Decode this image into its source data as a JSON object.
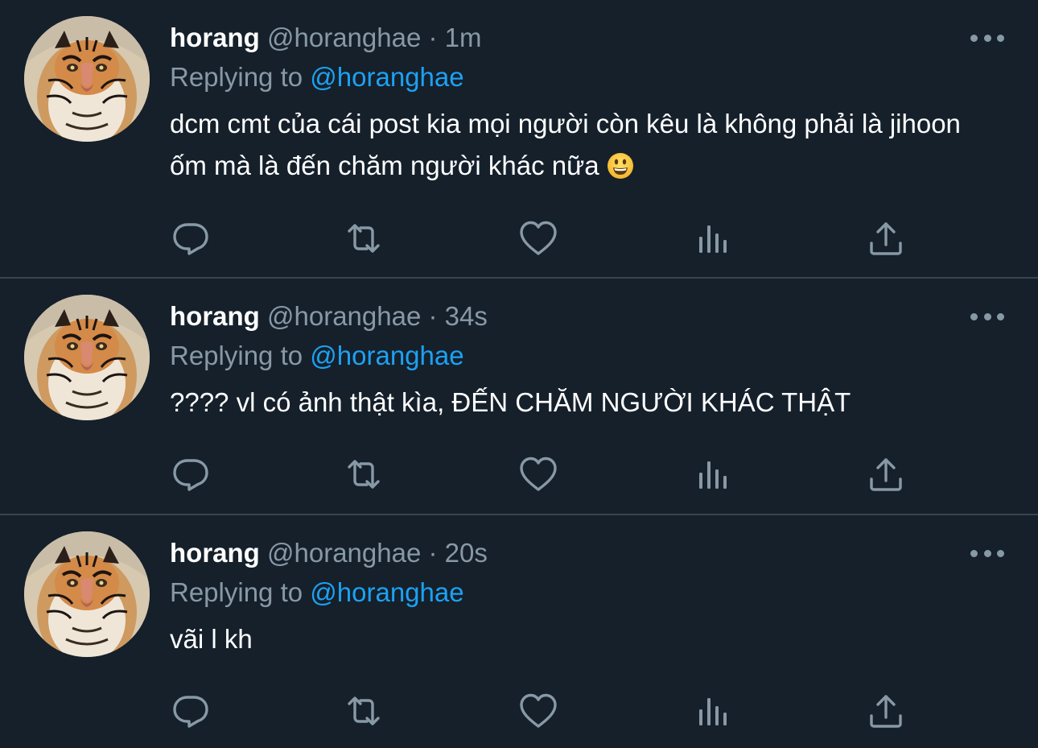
{
  "colors": {
    "background": "#15202b",
    "divider": "#38444d",
    "muted": "#8899a6",
    "link": "#1da1f2",
    "text": "#ffffff"
  },
  "tweets": [
    {
      "name": "horang",
      "handle": "@horanghae",
      "separator": "·",
      "time": "1m",
      "replying_prefix": "Replying to",
      "replying_handle": "@horanghae",
      "text": "dcm cmt của cái post  kia mọi người còn kêu là không phải là jihoon ốm mà là đến chăm người khác nữa",
      "emoji": "grinning-face-emoji"
    },
    {
      "name": "horang",
      "handle": "@horanghae",
      "separator": "·",
      "time": "34s",
      "replying_prefix": "Replying to",
      "replying_handle": "@horanghae",
      "text": "???? vl có ảnh thật kìa, ĐẾN CHĂM NGƯỜI KHÁC THẬT"
    },
    {
      "name": "horang",
      "handle": "@horanghae",
      "separator": "·",
      "time": "20s",
      "replying_prefix": "Replying to",
      "replying_handle": "@horanghae",
      "text": "vãi l kh"
    }
  ],
  "icons": {
    "avatar": "tiger-avatar",
    "more": "more-options-icon",
    "reply": "reply-icon",
    "retweet": "retweet-icon",
    "like": "heart-icon",
    "stats": "analytics-icon",
    "share": "share-icon"
  }
}
